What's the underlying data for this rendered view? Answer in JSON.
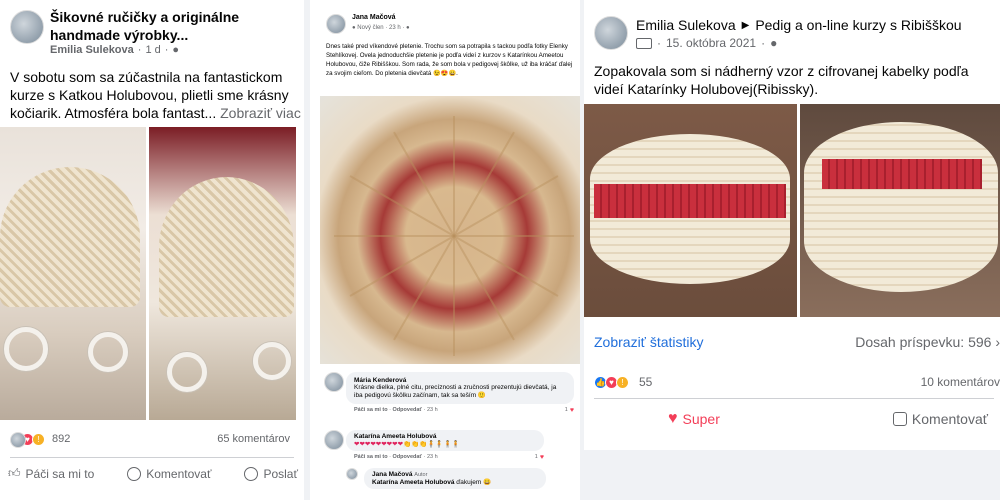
{
  "post1": {
    "group_title": "Šikovné ručičky a originálne handmade výrobky...",
    "author": "Emilia Sulekova",
    "time": "1 d",
    "text": "V sobotu som sa zúčastnila na fantastickom kurze s Katkou Holubovou, plietli sme krásny kočiarik. Atmosféra bola fantast...",
    "more_label": "Zobraziť viac",
    "reactions_count": "892",
    "comments_count": "65 komentárov",
    "actions": {
      "like": "Páči sa mi to",
      "comment": "Komentovať",
      "share": "Poslať"
    }
  },
  "post2": {
    "author": "Jana Mačová",
    "badge": "Nový člen",
    "time": "23 h",
    "text": "Dnes také pred víkendové pletenie. Trochu som sa potrapila s tackou podľa fotky Elenky Stehlíkovej. Ovela jednoduchšie pletenie je podľa videí z kurzov s Katarínkou Ameetou Holubovou, čiže Ribišškou. Som rada, že som bola v pedigovej škôlke, už iba kráčať ďalej za svojim cieľom. Do pletenia dievčatá 😉😍😀.",
    "comments": [
      {
        "author": "Mária Kenderová",
        "text": "Krásne dielka, plné citu, precíznosti a zručnosti prezentujú dievčatá, ja iba pedigovú škôlku začínam, tak sa teším 🙂",
        "like": "Páči sa mi to",
        "reply": "Odpovedať",
        "time": "23 h",
        "reacts": "1"
      },
      {
        "author": "Katarína Ameeta Holubová",
        "text": "❤❤❤❤❤❤❤❤❤👏👏👏🧍🧍🧍🧍",
        "like": "Páči sa mi to",
        "reply": "Odpovedať",
        "time": "23 h",
        "reacts": "1"
      },
      {
        "author": "Jana Mačová",
        "role": "Autor",
        "mention": "Katarína Ameeta Holubová",
        "text": "ďakujem 😀"
      }
    ]
  },
  "post3": {
    "author": "Emilia Sulekova",
    "group": "Pedig a on-line kurzy s Ribišškou",
    "date": "15. októbra 2021",
    "text": "Zopakovala som si nádherný vzor z cifrovanej kabelky podľa videí Katarínky Holubovej(Ribissky).",
    "stats_link": "Zobraziť štatistiky",
    "reach": "Dosah príspevku: 596",
    "reactions_count": "55",
    "comments_count": "10 komentárov",
    "actions": {
      "super": "Super",
      "comment": "Komentovať"
    }
  }
}
